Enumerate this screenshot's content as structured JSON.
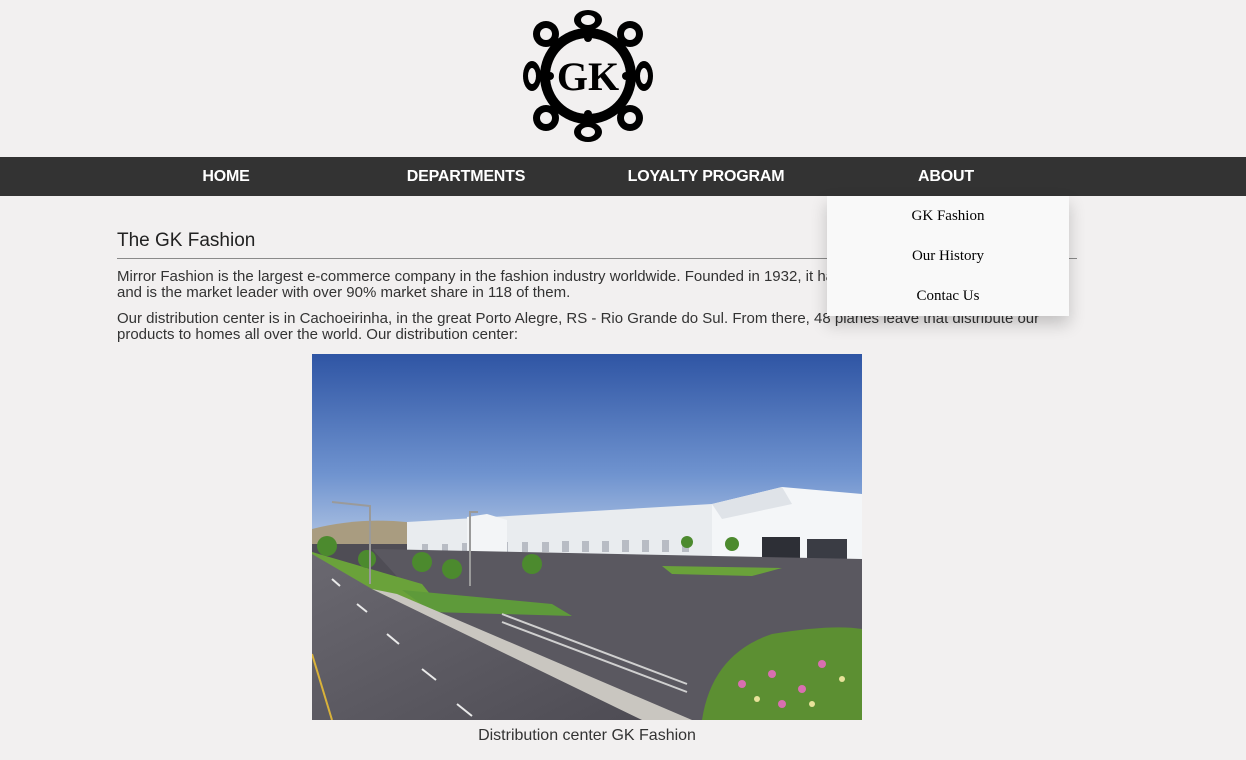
{
  "header": {
    "logo_text": "GK",
    "logo_icon": "ornamental-gk-logo"
  },
  "nav": {
    "items": [
      {
        "label": "HOME"
      },
      {
        "label": "DEPARTMENTS"
      },
      {
        "label": "LOYALTY PROGRAM"
      },
      {
        "label": "ABOUT"
      }
    ],
    "background": "#333333",
    "text_color": "#ffffff"
  },
  "dropdown": {
    "items": [
      {
        "label": "GK Fashion"
      },
      {
        "label": "Our History"
      },
      {
        "label": "Contac Us"
      }
    ],
    "background": "#f9f9f9"
  },
  "main": {
    "title": "The GK Fashion",
    "paragraph1": "Mirror Fashion is the largest e-commerce company in the fashion industry worldwide. Founded in 1932, it has branches in 124 countries, and is the market leader with over 90% market share in 118 of them.",
    "paragraph2": "Our distribution center is in Cachoeirinha, in the great Porto Alegre, RS - Rio Grande do Sul. From there, 48 planes leave that distribute our products to homes all over the world. Our distribution center:"
  },
  "figure": {
    "image": "distribution-center-photo",
    "caption": "Distribution center GK Fashion"
  },
  "colors": {
    "page_background": "#f2f0f0",
    "sky": "#4a6fb5",
    "asphalt": "#55535a",
    "grass": "#5e9a3a"
  }
}
